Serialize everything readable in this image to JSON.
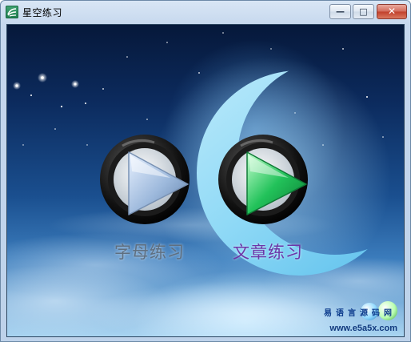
{
  "window": {
    "title": "星空练习",
    "controls": {
      "minimize": "—",
      "maximize": "□",
      "close": "✕"
    }
  },
  "menu": {
    "items": [
      {
        "label": "字母练习",
        "color": "#5f6f80"
      },
      {
        "label": "文章练习",
        "color": "#6d35a8"
      }
    ]
  },
  "watermark": {
    "brand": "易语言源码网",
    "url": "www.e5a5x.com"
  },
  "icons": {
    "app": "app-logo-icon",
    "play_letters": "play-button-icon",
    "play_article": "play-button-icon"
  },
  "colors": {
    "play_letters": "#b8d4f0",
    "play_article": "#22c25a"
  }
}
